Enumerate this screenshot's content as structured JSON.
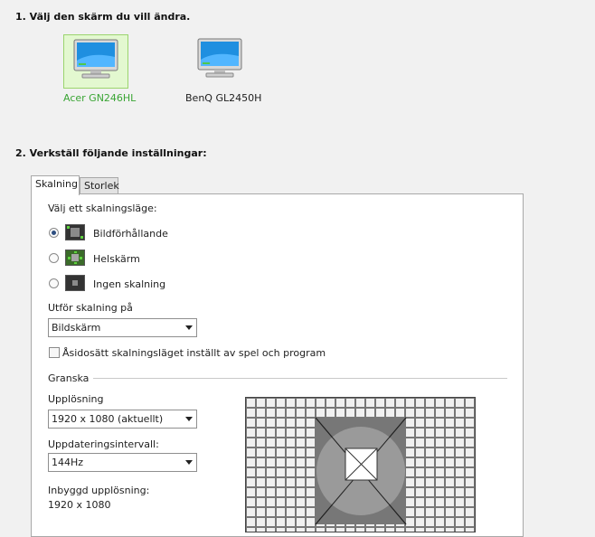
{
  "step1": {
    "heading": "1. Välj den skärm du vill ändra."
  },
  "displays": [
    {
      "name": "Acer GN246HL",
      "selected": true
    },
    {
      "name": "BenQ GL2450H",
      "selected": false
    }
  ],
  "step2": {
    "heading": "2. Verkställ följande inställningar:"
  },
  "tabs": [
    {
      "label": "Skalning",
      "active": true
    },
    {
      "label": "Storlek",
      "active": false
    }
  ],
  "scaling": {
    "mode_label": "Välj ett skalningsläge:",
    "modes": [
      {
        "label": "Bildförhållande",
        "checked": true,
        "icon": "aspect-ratio-icon"
      },
      {
        "label": "Helskärm",
        "checked": false,
        "icon": "full-screen-icon"
      },
      {
        "label": "Ingen skalning",
        "checked": false,
        "icon": "no-scaling-icon"
      }
    ],
    "perform_on_label": "Utför skalning på",
    "perform_on_value": "Bildskärm",
    "override_label": "Åsidosätt skalningsläget inställt av spel och program",
    "override_checked": false
  },
  "preview": {
    "section_label": "Granska",
    "resolution_label": "Upplösning",
    "resolution_value": "1920 x 1080 (aktuellt)",
    "refresh_label": "Uppdateringsintervall:",
    "refresh_value": "144Hz",
    "native_label": "Inbyggd upplösning:",
    "native_value": "1920 x 1080"
  },
  "colors": {
    "selected_label": "#3aa534",
    "selected_bg": "#e3f8d0",
    "radio_dot": "#2d4e80"
  }
}
